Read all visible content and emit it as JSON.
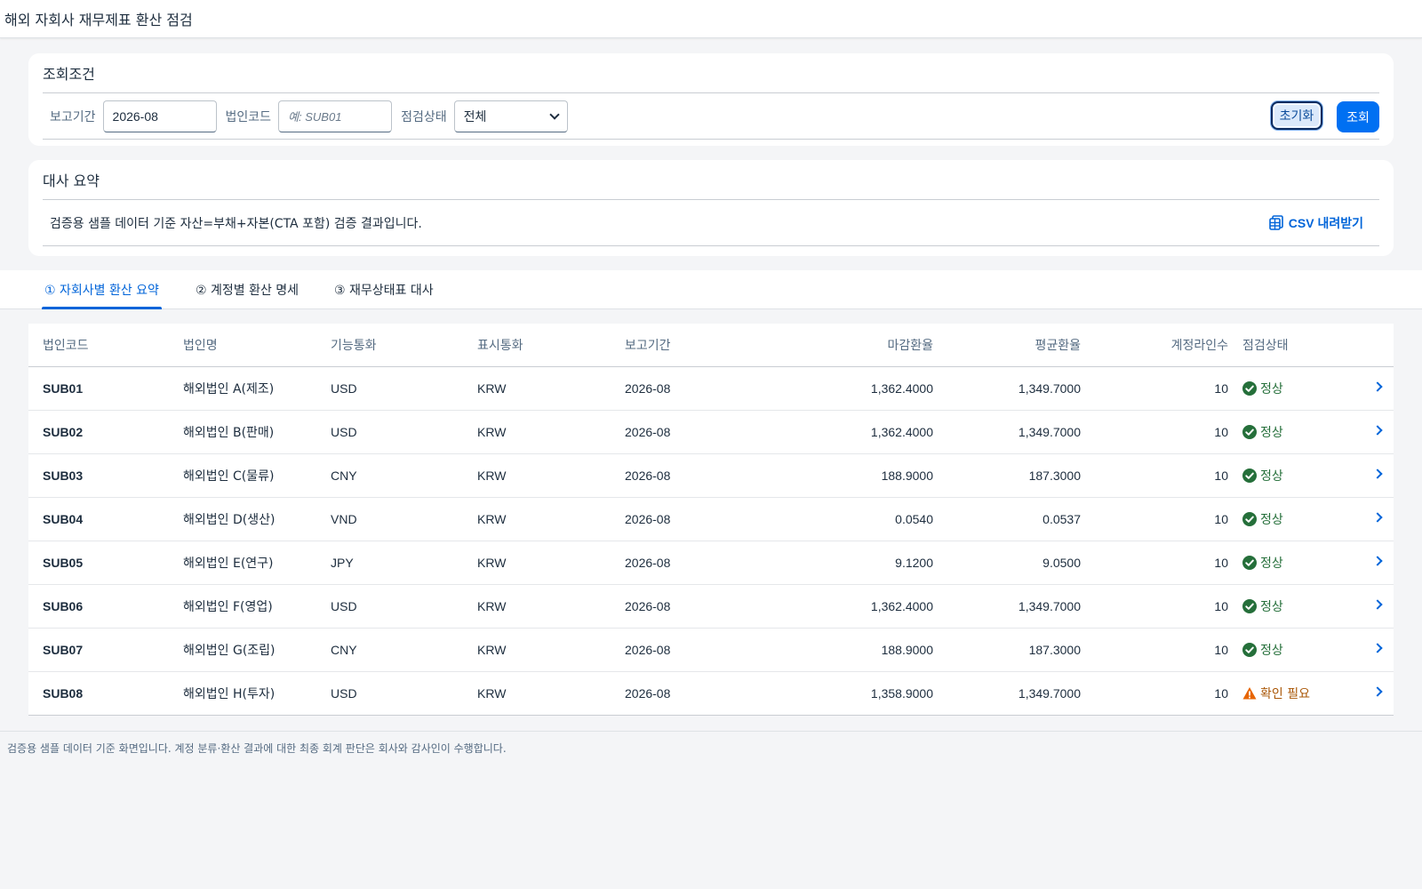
{
  "app": {
    "title": "해외 자회사 재무제표 환산 점검"
  },
  "filter": {
    "title": "조회조건",
    "period_label": "보고기간",
    "period_value": "2026-08",
    "code_label": "법인코드",
    "code_placeholder": "예: SUB01",
    "status_label": "점검상태",
    "status_value": "전체",
    "reset_label": "초기화",
    "search_label": "조회"
  },
  "summary": {
    "title": "대사 요약",
    "text": "검증용 샘플 데이터 기준 자산=부채+자본(CTA 포함) 검증 결과입니다.",
    "csv_label": "CSV 내려받기"
  },
  "tabs": [
    {
      "label": "① 자회사별 환산 요약"
    },
    {
      "label": "② 계정별 환산 명세"
    },
    {
      "label": "③ 재무상태표 대사"
    }
  ],
  "table": {
    "headers": [
      "법인코드",
      "법인명",
      "기능통화",
      "표시통화",
      "보고기간",
      "마감환율",
      "평균환율",
      "계정라인수",
      "점검상태"
    ],
    "rows": [
      {
        "code": "SUB01",
        "name": "해외법인 A(제조)",
        "func": "USD",
        "pres": "KRW",
        "period": "2026-08",
        "close": "1,362.4000",
        "avg": "1,349.7000",
        "lines": "10",
        "status": "정상",
        "status_type": "ok"
      },
      {
        "code": "SUB02",
        "name": "해외법인 B(판매)",
        "func": "USD",
        "pres": "KRW",
        "period": "2026-08",
        "close": "1,362.4000",
        "avg": "1,349.7000",
        "lines": "10",
        "status": "정상",
        "status_type": "ok"
      },
      {
        "code": "SUB03",
        "name": "해외법인 C(물류)",
        "func": "CNY",
        "pres": "KRW",
        "period": "2026-08",
        "close": "188.9000",
        "avg": "187.3000",
        "lines": "10",
        "status": "정상",
        "status_type": "ok"
      },
      {
        "code": "SUB04",
        "name": "해외법인 D(생산)",
        "func": "VND",
        "pres": "KRW",
        "period": "2026-08",
        "close": "0.0540",
        "avg": "0.0537",
        "lines": "10",
        "status": "정상",
        "status_type": "ok"
      },
      {
        "code": "SUB05",
        "name": "해외법인 E(연구)",
        "func": "JPY",
        "pres": "KRW",
        "period": "2026-08",
        "close": "9.1200",
        "avg": "9.0500",
        "lines": "10",
        "status": "정상",
        "status_type": "ok"
      },
      {
        "code": "SUB06",
        "name": "해외법인 F(영업)",
        "func": "USD",
        "pres": "KRW",
        "period": "2026-08",
        "close": "1,362.4000",
        "avg": "1,349.7000",
        "lines": "10",
        "status": "정상",
        "status_type": "ok"
      },
      {
        "code": "SUB07",
        "name": "해외법인 G(조립)",
        "func": "CNY",
        "pres": "KRW",
        "period": "2026-08",
        "close": "188.9000",
        "avg": "187.3000",
        "lines": "10",
        "status": "정상",
        "status_type": "ok"
      },
      {
        "code": "SUB08",
        "name": "해외법인 H(투자)",
        "func": "USD",
        "pres": "KRW",
        "period": "2026-08",
        "close": "1,358.9000",
        "avg": "1,349.7000",
        "lines": "10",
        "status": "확인 필요",
        "status_type": "warn"
      }
    ]
  },
  "colors": {
    "accent": "#0070f2",
    "link": "#0064d9",
    "ok": "#256f3a",
    "warn": "#aa5808"
  },
  "icons": {
    "ok": "check-circle-icon",
    "warn": "warning-triangle-icon",
    "row_nav": "chevron-right-icon",
    "csv": "spreadsheet-icon",
    "select": "chevron-down-icon"
  },
  "footer": {
    "note": "검증용 샘플 데이터 기준 화면입니다. 계정 분류·환산 결과에 대한 최종 회계 판단은 회사와 감사인이 수행합니다."
  }
}
